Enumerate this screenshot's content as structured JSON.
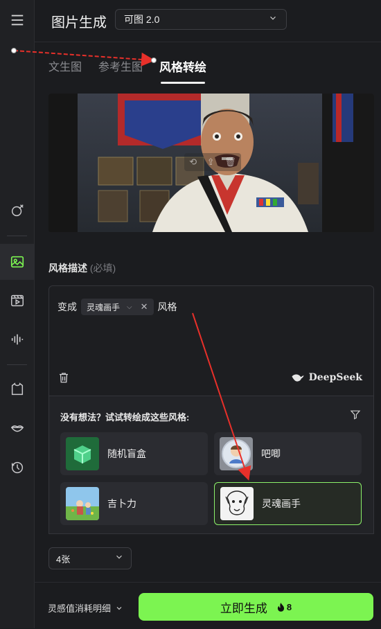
{
  "header": {
    "title": "图片生成",
    "model_select": {
      "value": "可图 2.0"
    }
  },
  "tabs": [
    {
      "label": "文生图",
      "active": false
    },
    {
      "label": "参考生图",
      "active": false
    },
    {
      "label": "风格转绘",
      "active": true
    }
  ],
  "style_description": {
    "label": "风格描述",
    "required_note": "(必填)",
    "prompt_prefix": "变成",
    "prompt_chip": "灵魂画手",
    "prompt_suffix": "风格",
    "deepseek_label": "DeepSeek"
  },
  "style_suggestions": {
    "title": "没有想法？试试转绘成这些风格:",
    "items": [
      {
        "label": "随机盲盒",
        "selected": false
      },
      {
        "label": "吧唧",
        "selected": false
      },
      {
        "label": "吉卜力",
        "selected": false
      },
      {
        "label": "灵魂画手",
        "selected": true
      }
    ]
  },
  "count_select": {
    "value": "4张"
  },
  "footer": {
    "consume_label": "灵感值消耗明细",
    "generate_label": "立即生成",
    "generate_cost": "8"
  },
  "colors": {
    "accent": "#7cf451",
    "background": "#1b1c1f",
    "annotation_arrow": "#e8302a"
  }
}
